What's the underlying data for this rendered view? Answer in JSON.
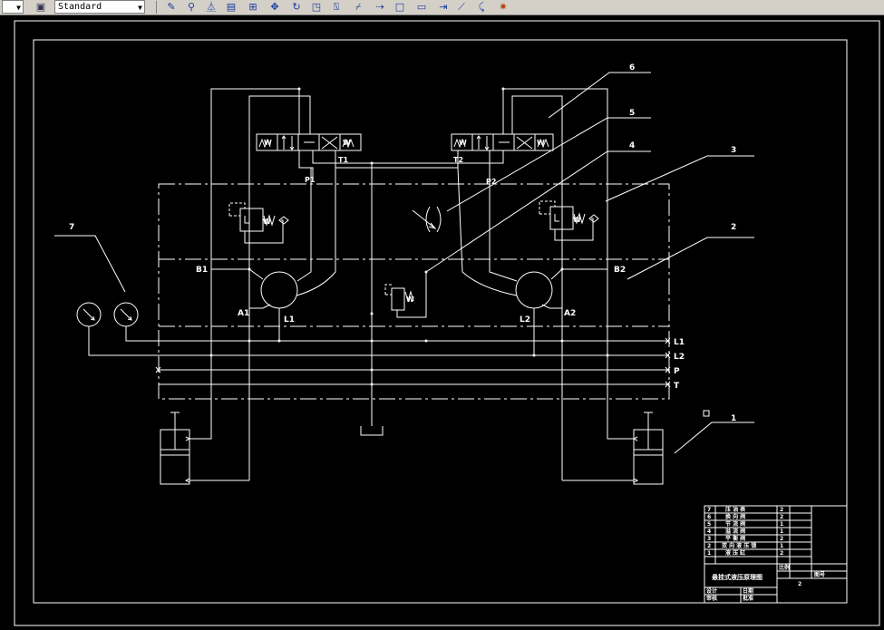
{
  "toolbar": {
    "style_dropdown": "Standard",
    "icons": [
      "pencil-icon",
      "link-icon",
      "mirror-icon",
      "hatch-icon",
      "array-icon",
      "move-icon",
      "rotate-icon",
      "scale-icon",
      "stretch-icon",
      "trim-icon",
      "extend-icon",
      "rectangle-icon",
      "square-icon",
      "break-icon",
      "chamfer-icon",
      "fillet-icon",
      "explode-icon"
    ]
  },
  "drawing": {
    "callouts": [
      "6",
      "5",
      "4",
      "3",
      "2",
      "7",
      "1"
    ],
    "ports": {
      "p1": "P1",
      "p2": "P2",
      "t1": "T1",
      "t2": "T2",
      "a1": "A1",
      "b1": "B1",
      "a2": "A2",
      "b2": "B2",
      "l1": "L1",
      "l2": "L2"
    },
    "line_labels": [
      "L1",
      "L2",
      "P",
      "T"
    ],
    "spring_marks": [
      "W",
      "W",
      "W",
      "W",
      "W",
      "W",
      "W"
    ]
  },
  "title_block": {
    "parts": [
      {
        "no": "7",
        "name": "压 油 表",
        "qty": "2"
      },
      {
        "no": "6",
        "name": "换 向 阀",
        "qty": "2"
      },
      {
        "no": "5",
        "name": "节 流 阀",
        "qty": "1"
      },
      {
        "no": "4",
        "name": "溢 流 阀",
        "qty": "1"
      },
      {
        "no": "3",
        "name": "平 衡 阀",
        "qty": "2"
      },
      {
        "no": "2",
        "name": "双 向 液 压 锁",
        "qty": "1"
      },
      {
        "no": "1",
        "name": "液 压 缸",
        "qty": "2"
      }
    ],
    "drawing_name": "悬挂式液压原理图",
    "sheet_label": "图号",
    "scale_label": "比例",
    "count": "2",
    "design_label": "设计",
    "check_label": "审核",
    "approve_label": "批准",
    "date_label": "日期"
  }
}
